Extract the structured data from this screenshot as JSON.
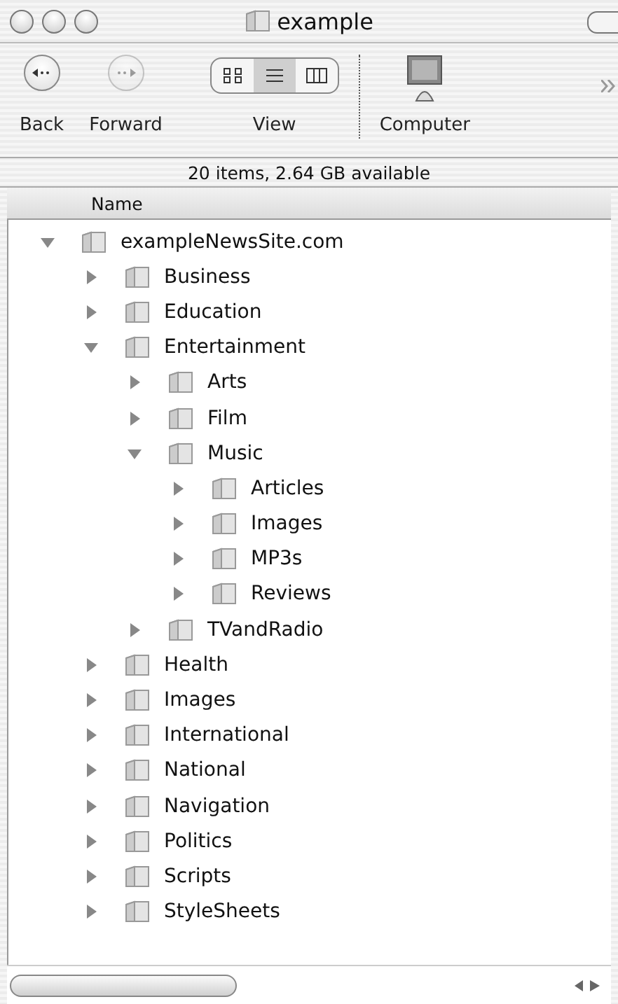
{
  "window": {
    "title": "example"
  },
  "toolbar": {
    "items": [
      {
        "kind": "back",
        "label": "Back",
        "disabled": false
      },
      {
        "kind": "forward",
        "label": "Forward",
        "disabled": true
      },
      {
        "kind": "view",
        "label": "View",
        "modes": [
          {
            "kind": "icon",
            "selected": false
          },
          {
            "kind": "list",
            "selected": true
          },
          {
            "kind": "column",
            "selected": false
          }
        ]
      },
      {
        "kind": "computer",
        "label": "Computer"
      }
    ]
  },
  "status_bar": "20 items, 2.64 GB available",
  "columns": [
    "Name"
  ],
  "tree": [
    {
      "name": "exampleNewsSite.com",
      "expanded": true,
      "children": [
        {
          "name": "Business",
          "expanded": false
        },
        {
          "name": "Education",
          "expanded": false
        },
        {
          "name": "Entertainment",
          "expanded": true,
          "children": [
            {
              "name": "Arts",
              "expanded": false
            },
            {
              "name": "Film",
              "expanded": false
            },
            {
              "name": "Music",
              "expanded": true,
              "children": [
                {
                  "name": "Articles",
                  "expanded": false
                },
                {
                  "name": "Images",
                  "expanded": false
                },
                {
                  "name": "MP3s",
                  "expanded": false
                },
                {
                  "name": "Reviews",
                  "expanded": false
                }
              ]
            },
            {
              "name": "TVandRadio",
              "expanded": false
            }
          ]
        },
        {
          "name": "Health",
          "expanded": false
        },
        {
          "name": "Images",
          "expanded": false
        },
        {
          "name": "International",
          "expanded": false
        },
        {
          "name": "National",
          "expanded": false
        },
        {
          "name": "Navigation",
          "expanded": false
        },
        {
          "name": "Politics",
          "expanded": false
        },
        {
          "name": "Scripts",
          "expanded": false
        },
        {
          "name": "StyleSheets",
          "expanded": false
        }
      ]
    }
  ]
}
